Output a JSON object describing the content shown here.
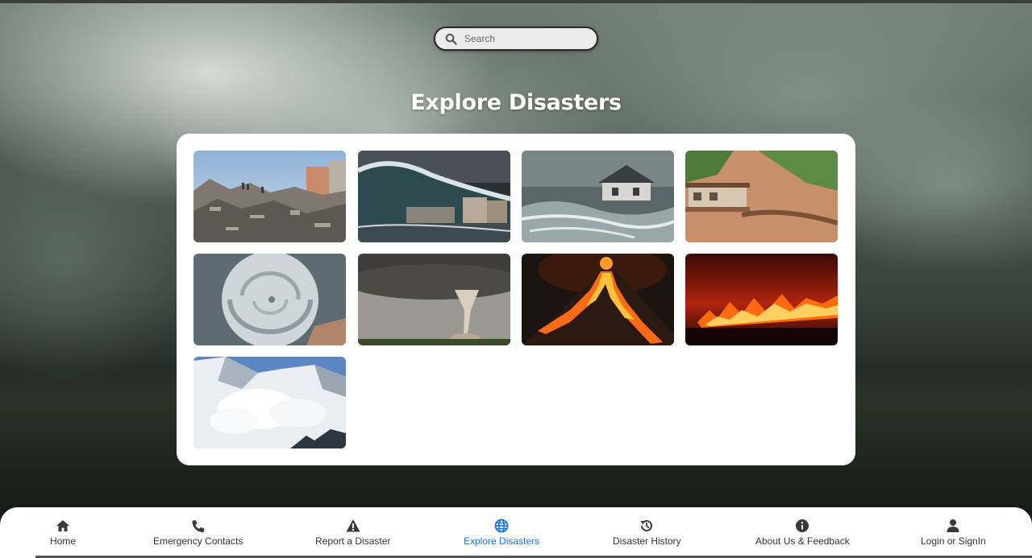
{
  "search": {
    "placeholder": "Search"
  },
  "page": {
    "title": "Explore Disasters"
  },
  "disasters": [
    {
      "icon": "earthquake-image"
    },
    {
      "icon": "tsunami-image"
    },
    {
      "icon": "flood-image"
    },
    {
      "icon": "landslide-image"
    },
    {
      "icon": "hurricane-image"
    },
    {
      "icon": "tornado-image"
    },
    {
      "icon": "volcano-image"
    },
    {
      "icon": "wildfire-image"
    },
    {
      "icon": "avalanche-image"
    }
  ],
  "nav": {
    "items": [
      {
        "label": "Home",
        "icon": "home-icon"
      },
      {
        "label": "Emergency Contacts",
        "icon": "phone-icon"
      },
      {
        "label": "Report a Disaster",
        "icon": "warning-icon"
      },
      {
        "label": "Explore Disasters",
        "icon": "globe-icon",
        "active": true
      },
      {
        "label": "Disaster History",
        "icon": "history-icon"
      },
      {
        "label": "About Us & Feedback",
        "icon": "info-icon"
      },
      {
        "label": "Login or SignIn",
        "icon": "user-icon"
      }
    ],
    "active_color": "#1a73e8"
  }
}
